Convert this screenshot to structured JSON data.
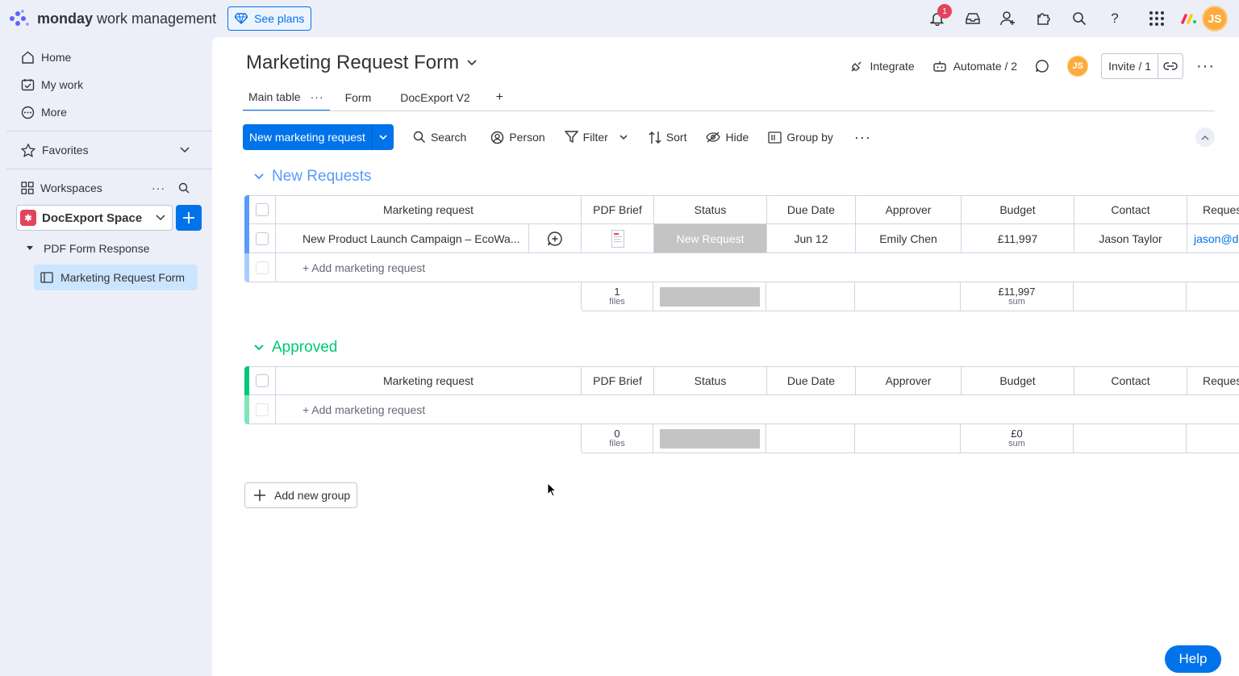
{
  "topbar": {
    "brand_bold": "monday",
    "brand_rest": " work management",
    "see_plans": "See plans",
    "notif_count": "1",
    "avatar": "JS",
    "icons": [
      "bell-icon",
      "inbox-icon",
      "invite-members-icon",
      "apps-icon",
      "search-icon",
      "help-icon",
      "apps-grid-icon",
      "monday-logo-icon"
    ]
  },
  "sidebar": {
    "nav": [
      {
        "label": "Home",
        "icon": "home-icon"
      },
      {
        "label": "My work",
        "icon": "my-work-icon"
      },
      {
        "label": "More",
        "icon": "more-icon"
      }
    ],
    "favorites": "Favorites",
    "workspaces": "Workspaces",
    "workspace_name": "DocExport Space",
    "folder": "PDF Form Response",
    "active_board": "Marketing Request Form"
  },
  "board": {
    "title": "Marketing Request Form",
    "integrate": "Integrate",
    "automate": "Automate / 2",
    "avatar": "JS",
    "invite": "Invite / 1",
    "tabs": [
      "Main table",
      "Form",
      "DocExport V2"
    ],
    "add_tab": "+"
  },
  "toolbar": {
    "new_item": "New marketing request",
    "search": "Search",
    "person": "Person",
    "filter": "Filter",
    "sort": "Sort",
    "hide": "Hide",
    "group_by": "Group by"
  },
  "columns": [
    "Marketing request",
    "PDF Brief",
    "Status",
    "Due Date",
    "Approver",
    "Budget",
    "Contact",
    "Reques"
  ],
  "groups": [
    {
      "title": "New Requests",
      "color": "#579bfc",
      "rows": [
        {
          "name": "New Product Launch Campaign – EcoWa...",
          "status": "New Request",
          "due": "Jun 12",
          "approver": "Emily Chen",
          "budget": "£11,997",
          "contact": "Jason Taylor",
          "request": "jason@d"
        }
      ],
      "add_item": "+ Add marketing request",
      "summary": {
        "files": "1",
        "files_label": "files",
        "budget": "£11,997",
        "budget_label": "sum"
      }
    },
    {
      "title": "Approved",
      "color": "#00c875",
      "rows": [],
      "add_item": "+ Add marketing request",
      "summary": {
        "files": "0",
        "files_label": "files",
        "budget": "£0",
        "budget_label": "sum"
      }
    }
  ],
  "add_group": "Add new group",
  "help": "Help"
}
